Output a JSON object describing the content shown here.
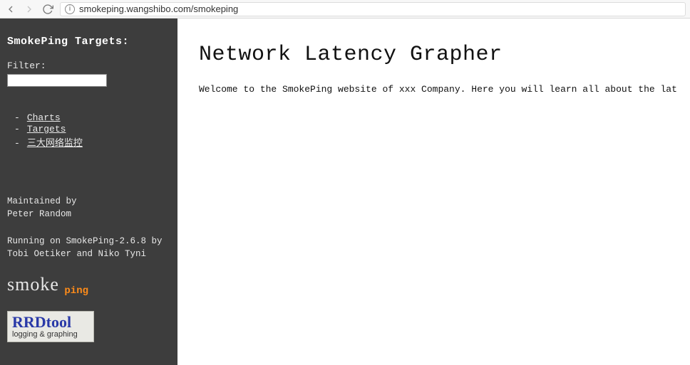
{
  "browser": {
    "url": "smokeping.wangshibo.com/smokeping"
  },
  "sidebar": {
    "title": "SmokePing Targets:",
    "filter_label": "Filter:",
    "filter_value": "",
    "nav": [
      {
        "label": "Charts"
      },
      {
        "label": "Targets"
      },
      {
        "label": "三大网络监控"
      }
    ],
    "footer": {
      "maintained_by": "Maintained by",
      "maintainer": "Peter Random",
      "running": "Running on SmokePing-2.6.8 by",
      "authors": "Tobi Oetiker and Niko Tyni"
    },
    "logos": {
      "smoke": "smoke",
      "ping": "ping",
      "rrdtool_top": "RRDtool",
      "rrdtool_bot": "logging & graphing"
    }
  },
  "main": {
    "title": "Network Latency Grapher",
    "welcome": "Welcome to the SmokePing website of xxx Company. Here you will learn all about the lat"
  }
}
